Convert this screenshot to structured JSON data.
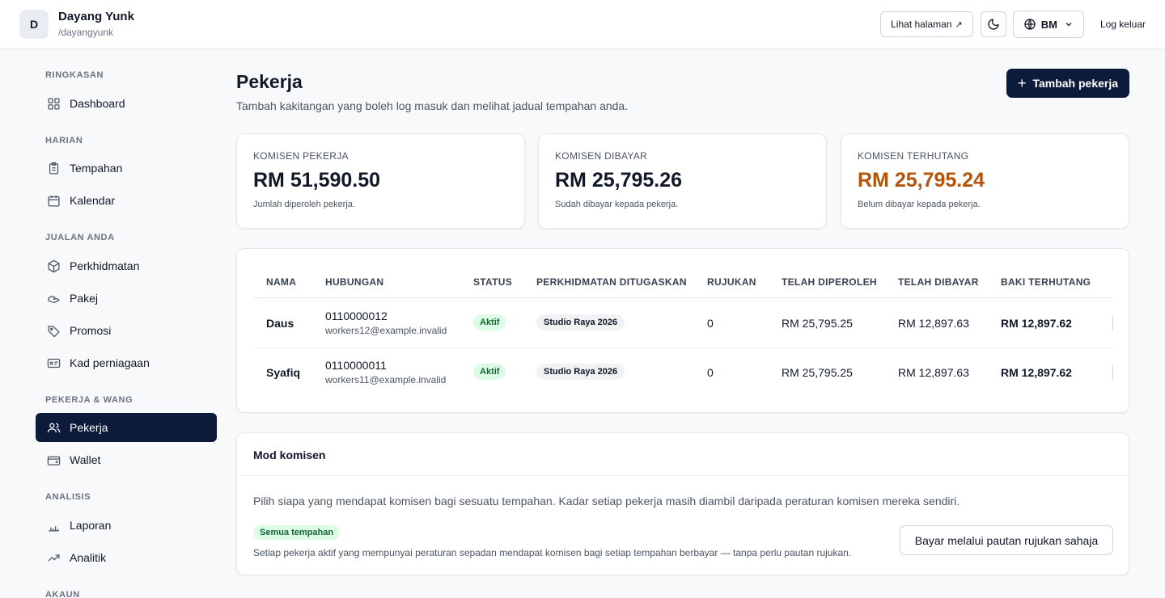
{
  "header": {
    "avatar_letter": "D",
    "name": "Dayang Yunk",
    "handle": "/dayangyunk",
    "view_page": "Lihat halaman",
    "view_arrow": "↗",
    "lang": "BM",
    "logout": "Log keluar"
  },
  "sidebar": {
    "sections": [
      {
        "title": "RINGKASAN"
      },
      {
        "title": "HARIAN"
      },
      {
        "title": "JUALAN ANDA"
      },
      {
        "title": "PEKERJA & WANG"
      },
      {
        "title": "ANALISIS"
      },
      {
        "title": "AKAUN"
      }
    ],
    "items": [
      {
        "label": "Dashboard",
        "icon": "grid-icon"
      },
      {
        "label": "Tempahan",
        "icon": "clipboard-icon"
      },
      {
        "label": "Kalendar",
        "icon": "calendar-icon"
      },
      {
        "label": "Perkhidmatan",
        "icon": "box-icon"
      },
      {
        "label": "Pakej",
        "icon": "hand-icon"
      },
      {
        "label": "Promosi",
        "icon": "tag-icon"
      },
      {
        "label": "Kad perniagaan",
        "icon": "id-card-icon"
      },
      {
        "label": "Pekerja",
        "icon": "users-icon",
        "active": true
      },
      {
        "label": "Wallet",
        "icon": "wallet-icon"
      },
      {
        "label": "Laporan",
        "icon": "bar-chart-icon"
      },
      {
        "label": "Analitik",
        "icon": "trend-icon"
      }
    ]
  },
  "main": {
    "title": "Pekerja",
    "subtitle": "Tambah kakitangan yang boleh log masuk dan melihat jadual tempahan anda.",
    "add_button": "Tambah pekerja",
    "stats": [
      {
        "label": "KOMISEN PEKERJA",
        "value": "RM 51,590.50",
        "note": "Jumlah diperoleh pekerja."
      },
      {
        "label": "KOMISEN DIBAYAR",
        "value": "RM 25,795.26",
        "note": "Sudah dibayar kepada pekerja."
      },
      {
        "label": "KOMISEN TERHUTANG",
        "value": "RM 25,795.24",
        "note": "Belum dibayar kepada pekerja."
      }
    ],
    "table": {
      "headers": [
        "NAMA",
        "HUBUNGAN",
        "STATUS",
        "PERKHIDMATAN DITUGASKAN",
        "RUJUKAN",
        "TELAH DIPEROLEH",
        "TELAH DIBAYAR",
        "BAKI TERHUTANG"
      ],
      "rows": [
        {
          "name": "Daus",
          "phone": "0110000012",
          "email": "workers12@example.invalid",
          "status": "Aktif",
          "service": "Studio Raya 2026",
          "referrals": "0",
          "earned": "RM 25,795.25",
          "paid": "RM 12,897.63",
          "balance": "RM 12,897.62"
        },
        {
          "name": "Syafiq",
          "phone": "0110000011",
          "email": "workers11@example.invalid",
          "status": "Aktif",
          "service": "Studio Raya 2026",
          "referrals": "0",
          "earned": "RM 25,795.25",
          "paid": "RM 12,897.63",
          "balance": "RM 12,897.62"
        }
      ]
    },
    "commission_mode": {
      "title": "Mod komisen",
      "description": "Pilih siapa yang mendapat komisen bagi sesuatu tempahan. Kadar setiap pekerja masih diambil daripada peraturan komisen mereka sendiri.",
      "badge": "Semua tempahan",
      "note": "Setiap pekerja aktif yang mempunyai peraturan sepadan mendapat komisen bagi setiap tempahan berbayar — tanpa perlu pautan rujukan.",
      "button": "Bayar melalui pautan rujukan sahaja"
    }
  },
  "colors": {
    "primary": "#0d1b3a",
    "warning": "#b45309",
    "success_bg": "#dcfce7",
    "success_text": "#166534"
  }
}
